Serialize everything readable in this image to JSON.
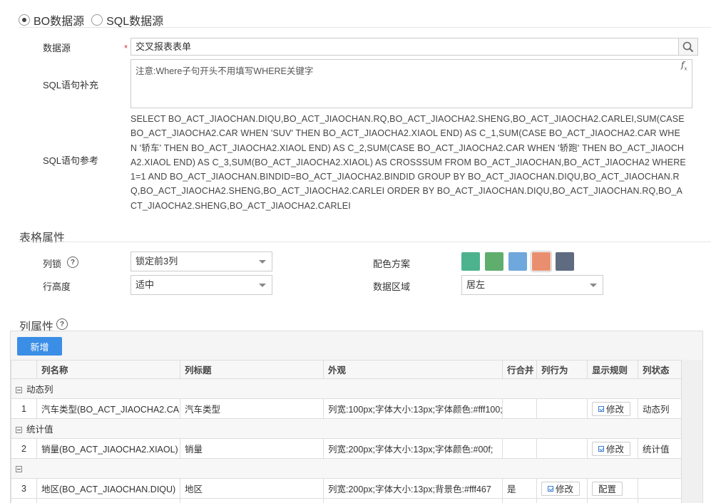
{
  "source": {
    "options": [
      {
        "label": "BO数据源",
        "checked": true
      },
      {
        "label": "SQL数据源",
        "checked": false
      }
    ],
    "datasource_label": "数据源",
    "datasource_value": "交叉报表表单",
    "required_mark": "*",
    "sql_supplement_label": "SQL语句补充",
    "sql_supplement_placeholder": "注意:Where子句开头不用填写WHERE关键字",
    "sql_reference_label": "SQL语句参考",
    "sql_reference_text": "SELECT BO_ACT_JIAOCHAN.DIQU,BO_ACT_JIAOCHAN.RQ,BO_ACT_JIAOCHA2.SHENG,BO_ACT_JIAOCHA2.CARLEI,SUM(CASE BO_ACT_JIAOCHA2.CAR WHEN 'SUV' THEN BO_ACT_JIAOCHA2.XIAOL END) AS C_1,SUM(CASE BO_ACT_JIAOCHA2.CAR WHEN '轿车' THEN BO_ACT_JIAOCHA2.XIAOL END) AS C_2,SUM(CASE BO_ACT_JIAOCHA2.CAR WHEN '轿跑' THEN BO_ACT_JIAOCHA2.XIAOL END) AS C_3,SUM(BO_ACT_JIAOCHA2.XIAOL) AS CROSSSUM FROM BO_ACT_JIAOCHAN,BO_ACT_JIAOCHA2 WHERE 1=1 AND BO_ACT_JIAOCHAN.BINDID=BO_ACT_JIAOCHA2.BINDID GROUP BY BO_ACT_JIAOCHAN.DIQU,BO_ACT_JIAOCHAN.RQ,BO_ACT_JIAOCHA2.SHENG,BO_ACT_JIAOCHA2.CARLEI ORDER BY BO_ACT_JIAOCHAN.DIQU,BO_ACT_JIAOCHAN.RQ,BO_ACT_JIAOCHA2.SHENG,BO_ACT_JIAOCHA2.CARLEI"
  },
  "table_props": {
    "title": "表格属性",
    "col_lock_label": "列锁",
    "col_lock_value": "锁定前3列",
    "row_height_label": "行高度",
    "row_height_value": "适中",
    "color_scheme_label": "配色方案",
    "color_swatches": [
      "#4db38e",
      "#5fae6e",
      "#6fa8dc",
      "#e98f6f",
      "#5f6b80"
    ],
    "data_area_label": "数据区域",
    "data_area_value": "居左",
    "help_glyph": "?"
  },
  "column_props": {
    "title": "列属性",
    "add_button": "新增",
    "headers": [
      "列名称",
      "列标题",
      "外观",
      "行合并",
      "列行为",
      "显示规则",
      "列状态"
    ],
    "groups": [
      {
        "name": "动态列",
        "rows": [
          {
            "no": "1",
            "name": "汽车类型(BO_ACT_JIAOCHA2.CAR)",
            "title": "汽车类型",
            "style": "列宽:100px;字体大小:13px;字体颜色:#fff100;",
            "merge": "",
            "behavior": "",
            "rule": "修改",
            "status": "动态列"
          }
        ]
      },
      {
        "name": "统计值",
        "rows": [
          {
            "no": "2",
            "name": "销量(BO_ACT_JIAOCHA2.XIAOL)",
            "title": "销量",
            "style": "列宽:200px;字体大小:13px;字体颜色:#00f;",
            "merge": "",
            "behavior": "",
            "rule": "修改",
            "status": "统计值"
          }
        ]
      },
      {
        "name": "",
        "rows": [
          {
            "no": "3",
            "name": "地区(BO_ACT_JIAOCHAN.DIQU)",
            "title": "地区",
            "style": "列宽:200px;字体大小:13px;背景色:#fff467",
            "merge": "是",
            "behavior": "修改",
            "rule": "配置",
            "status": ""
          }
        ]
      }
    ]
  }
}
